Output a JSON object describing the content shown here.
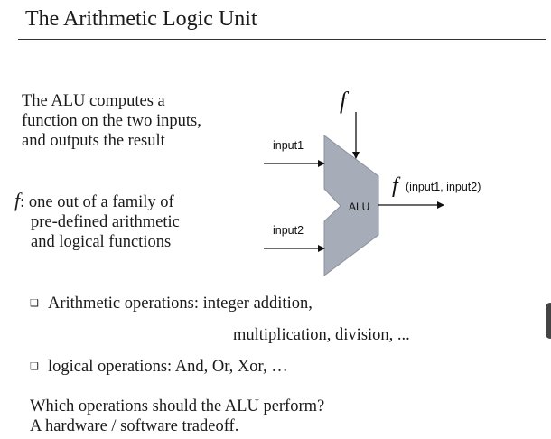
{
  "slide": {
    "title": "The Arithmetic Logic Unit",
    "intro_lines": [
      "The ALU computes a",
      "function on the two inputs,",
      "and outputs the result"
    ],
    "f_symbol": "f",
    "f_desc_first": ": one out of a family of",
    "f_desc_lines": [
      "pre-defined arithmetic",
      "and logical functions"
    ],
    "bullet_glyph": "❑",
    "bullets": [
      {
        "text": "Arithmetic operations: integer addition,",
        "continuation": "multiplication, division, ..."
      },
      {
        "text": "logical operations: And, Or, Xor, …"
      }
    ],
    "question_lines": [
      "Which operations should the ALU perform?",
      "A hardware / software tradeoff."
    ]
  },
  "diagram": {
    "f_label": "f",
    "input1_label": "input1",
    "input2_label": "input2",
    "alu_label": "ALU",
    "output_f": "f",
    "output_args": "(input1, input2)",
    "alu_fill": "#a6acb8",
    "alu_stroke": "#8a909c"
  }
}
